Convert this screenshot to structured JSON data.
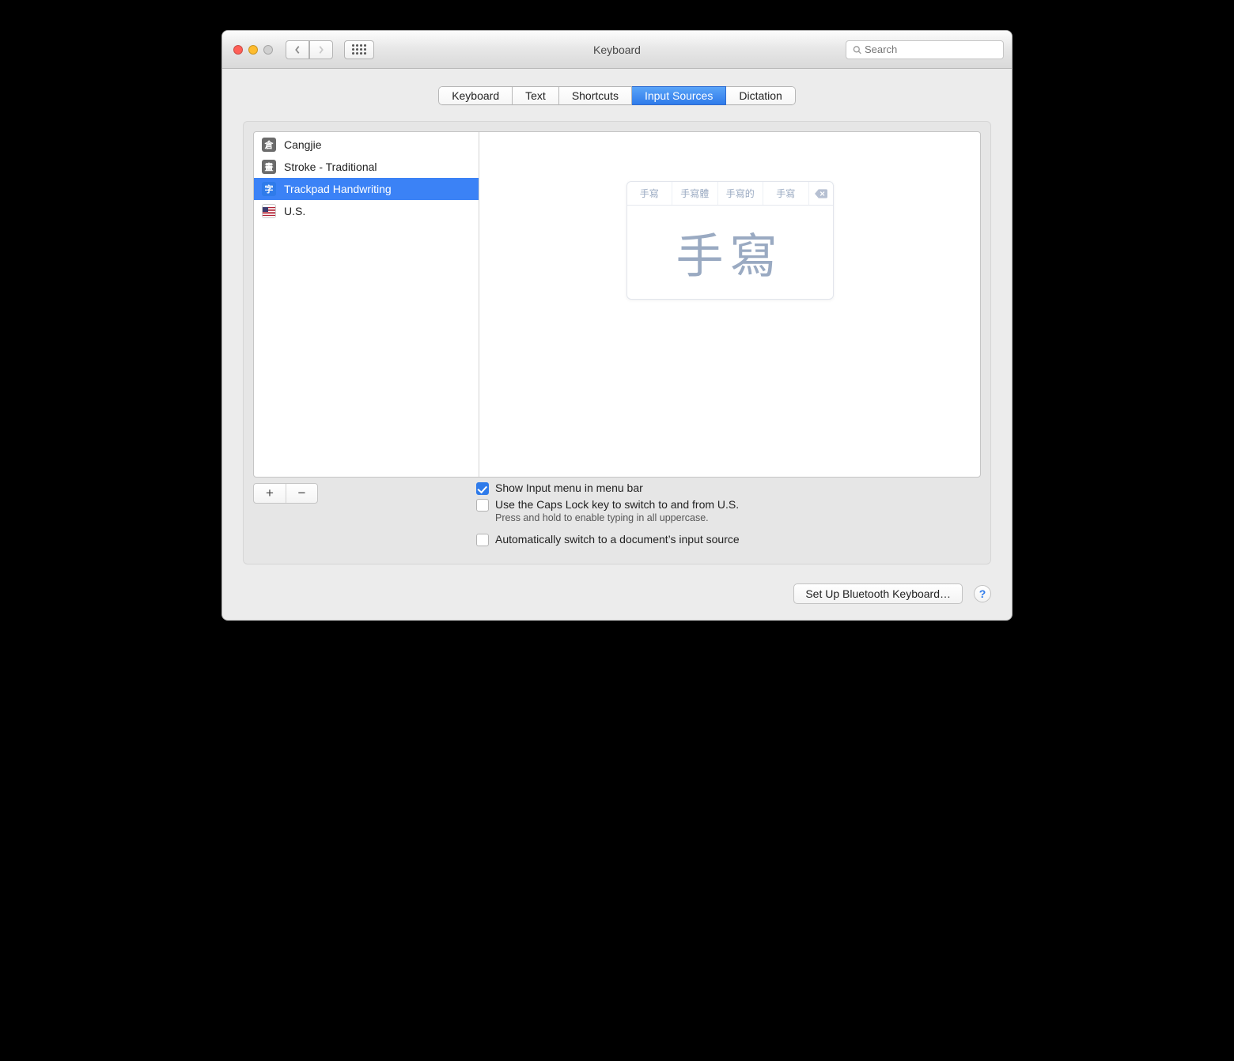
{
  "window": {
    "title": "Keyboard"
  },
  "search": {
    "placeholder": "Search"
  },
  "tabs": [
    {
      "label": "Keyboard",
      "active": false
    },
    {
      "label": "Text",
      "active": false
    },
    {
      "label": "Shortcuts",
      "active": false
    },
    {
      "label": "Input Sources",
      "active": true
    },
    {
      "label": "Dictation",
      "active": false
    }
  ],
  "sources": [
    {
      "label": "Cangjie",
      "icon": "倉",
      "iconStyle": "grey",
      "selected": false
    },
    {
      "label": "Stroke - Traditional",
      "icon": "畫",
      "iconStyle": "grey",
      "selected": false
    },
    {
      "label": "Trackpad Handwriting",
      "icon": "字",
      "iconStyle": "blue",
      "selected": true
    },
    {
      "label": "U.S.",
      "icon": "flag",
      "iconStyle": "flag",
      "selected": false
    }
  ],
  "handwriting": {
    "candidates": [
      "手寫",
      "手寫體",
      "手寫的",
      "手寫"
    ],
    "drawn": "手寫"
  },
  "options": {
    "showInputMenu": {
      "label": "Show Input menu in menu bar",
      "checked": true
    },
    "capsLockSwitch": {
      "label": "Use the Caps Lock key to switch to and from U.S.",
      "checked": false,
      "sub": "Press and hold to enable typing in all uppercase."
    },
    "autoSwitch": {
      "label": "Automatically switch to a document’s input source",
      "checked": false
    }
  },
  "footer": {
    "bluetooth": "Set Up Bluetooth Keyboard…",
    "help": "?"
  },
  "addRemove": {
    "add": "+",
    "remove": "−"
  }
}
